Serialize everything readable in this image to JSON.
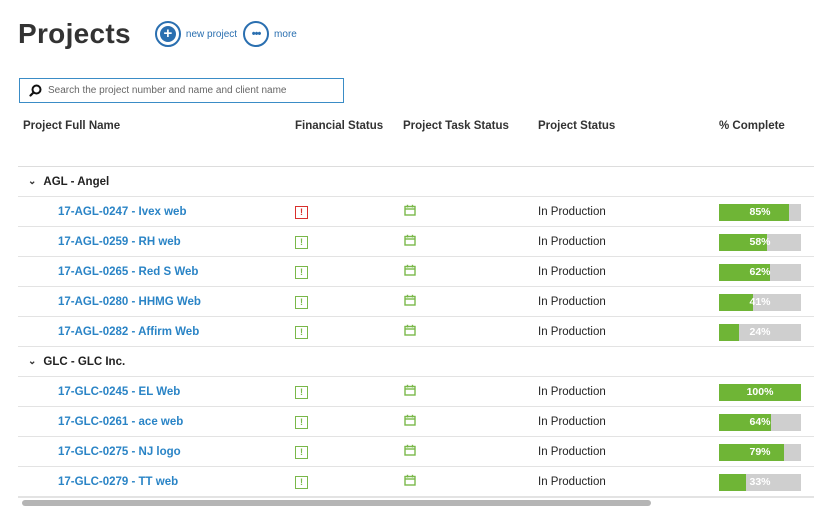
{
  "header": {
    "title": "Projects",
    "new_project": {
      "icon": "plus-icon",
      "label": "new project"
    },
    "more": {
      "icon": "more-dots-icon",
      "label": "more"
    }
  },
  "search": {
    "placeholder": "Search the project number and name and client name",
    "value": ""
  },
  "columns": {
    "name": "Project Full Name",
    "financial": "Financial Status",
    "task": "Project Task Status",
    "status": "Project Status",
    "complete": "% Complete"
  },
  "colors": {
    "link": "#2a84c6",
    "accent": "#2a6fb0",
    "progress_fill": "#6fb536",
    "progress_track": "#cfcfcf",
    "status_ok": "#7ab84a",
    "status_alert": "#d9302c"
  },
  "groups": [
    {
      "label": "AGL - Angel",
      "projects": [
        {
          "name": "17-AGL-0247 - Ivex web",
          "financial": "alert",
          "task_icon": "calendar-icon",
          "status": "In Production",
          "percent": 85,
          "percent_label": "85%"
        },
        {
          "name": "17-AGL-0259 - RH web",
          "financial": "ok",
          "task_icon": "calendar-icon",
          "status": "In Production",
          "percent": 58,
          "percent_label": "58%"
        },
        {
          "name": "17-AGL-0265 - Red S Web",
          "financial": "ok",
          "task_icon": "calendar-icon",
          "status": "In Production",
          "percent": 62,
          "percent_label": "62%"
        },
        {
          "name": "17-AGL-0280 - HHMG Web",
          "financial": "ok",
          "task_icon": "calendar-icon",
          "status": "In Production",
          "percent": 41,
          "percent_label": "41%"
        },
        {
          "name": "17-AGL-0282 - Affirm Web",
          "financial": "ok",
          "task_icon": "calendar-icon",
          "status": "In Production",
          "percent": 24,
          "percent_label": "24%"
        }
      ]
    },
    {
      "label": "GLC - GLC Inc.",
      "projects": [
        {
          "name": "17-GLC-0245 - EL Web",
          "financial": "ok",
          "task_icon": "calendar-icon",
          "status": "In Production",
          "percent": 100,
          "percent_label": "100%"
        },
        {
          "name": "17-GLC-0261 - ace web",
          "financial": "ok",
          "task_icon": "calendar-icon",
          "status": "In Production",
          "percent": 64,
          "percent_label": "64%"
        },
        {
          "name": "17-GLC-0275 - NJ logo",
          "financial": "ok",
          "task_icon": "calendar-icon",
          "status": "In Production",
          "percent": 79,
          "percent_label": "79%"
        },
        {
          "name": "17-GLC-0279 - TT web",
          "financial": "ok",
          "task_icon": "calendar-icon",
          "status": "In Production",
          "percent": 33,
          "percent_label": "33%"
        }
      ]
    }
  ]
}
